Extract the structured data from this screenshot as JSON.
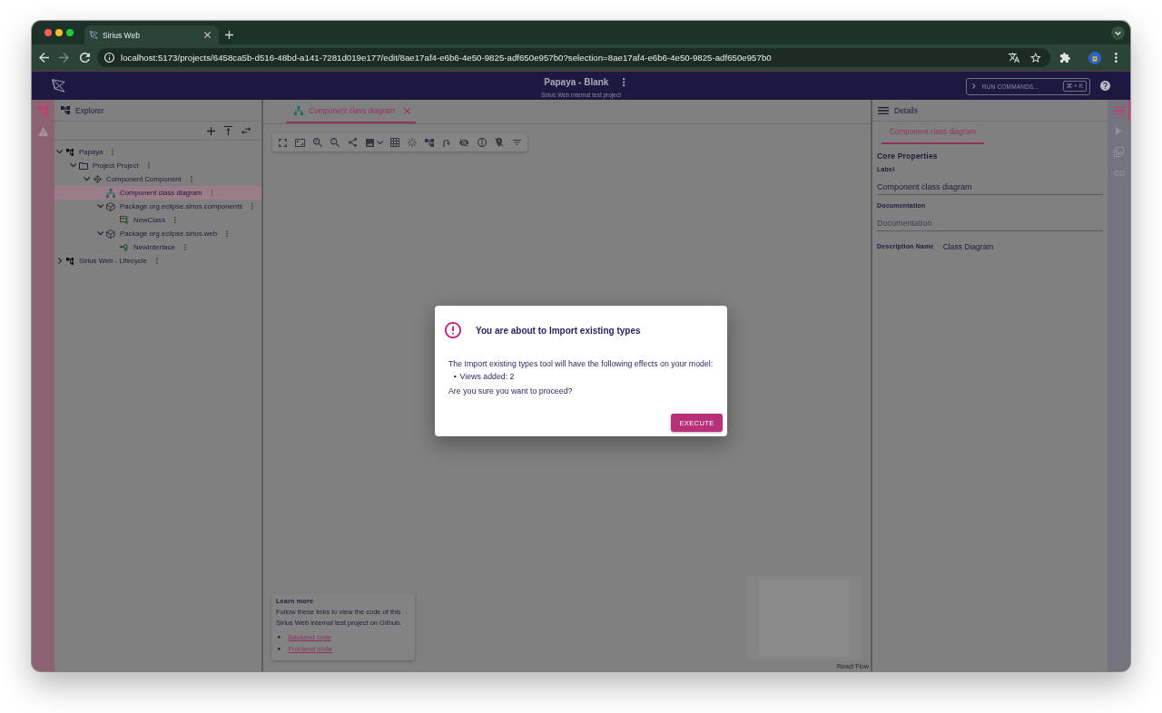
{
  "browser": {
    "tab": {
      "title": "Sirius Web"
    },
    "url": "localhost:5173/projects/6458ca5b-d516-48bd-a141-7281d019e177/edit/8ae17af4-e6b6-4e50-9825-adf650e957b0?selection=8ae17af4-e6b6-4e50-9825-adf650e957b0"
  },
  "app_bar": {
    "title": "Papaya - Blank",
    "subtitle": "Sirius Web internal test project",
    "command_palette": {
      "label": "RUN COMMANDS...",
      "shortcut": "⌘ + K"
    }
  },
  "left_sidebar": {
    "items": [
      {
        "kind": "explorer",
        "selected": true
      },
      {
        "kind": "validation",
        "selected": false
      }
    ]
  },
  "explorer": {
    "title": "Explorer",
    "tree": [
      {
        "label": "Papaya",
        "kind": "model",
        "expanded": true,
        "selected": false,
        "children": [
          {
            "label": "Project Project",
            "kind": "folder",
            "expanded": true,
            "selected": false,
            "children": [
              {
                "label": "Component Component",
                "kind": "component",
                "expanded": true,
                "selected": false,
                "children": [
                  {
                    "label": "Component class diagram",
                    "kind": "diagram",
                    "selected": true
                  },
                  {
                    "label": "Package org.eclipse.sirius.components",
                    "kind": "package",
                    "expanded": true,
                    "selected": false,
                    "children": [
                      {
                        "label": "NewClass",
                        "kind": "class",
                        "selected": false
                      }
                    ]
                  },
                  {
                    "label": "Package org.eclipse.sirius.web",
                    "kind": "package",
                    "expanded": true,
                    "selected": false,
                    "children": [
                      {
                        "label": "NewInterface",
                        "kind": "interface",
                        "selected": false
                      }
                    ]
                  }
                ]
              }
            ]
          }
        ]
      },
      {
        "label": "Sirius Web - Lifecycle",
        "kind": "model",
        "expanded": false,
        "selected": false
      }
    ]
  },
  "editor": {
    "tabs": [
      {
        "label": "Component class diagram",
        "selected": true
      }
    ],
    "learn_more": {
      "title": "Learn more",
      "text": "Follow these links to view the code of this Sirius Web internal test project on Github.",
      "links": [
        "Backend code",
        "Frontend code"
      ]
    },
    "attribution": "React Flow"
  },
  "details": {
    "title": "Details",
    "tabs": [
      {
        "label": "Component class diagram",
        "selected": true
      }
    ],
    "section": "Core Properties",
    "fields": [
      {
        "kind": "textfield",
        "label": "Label",
        "value": "Component class diagram"
      },
      {
        "kind": "textfield",
        "label": "Documentation",
        "placeholder": "Documentation"
      },
      {
        "kind": "label",
        "label": "Description Name",
        "value": "Class Diagram"
      }
    ]
  },
  "right_sidebar": {
    "items": [
      {
        "kind": "details",
        "selected": true
      },
      {
        "kind": "run",
        "selected": false
      },
      {
        "kind": "representations",
        "selected": false
      },
      {
        "kind": "links",
        "selected": false
      }
    ]
  },
  "dialog": {
    "title": "You are about to Import existing types",
    "text": "The Import existing types tool will have the following effects on your model:",
    "effects": [
      "Views added: 2"
    ],
    "question": "Are you sure you want to proceed?",
    "button": "EXECUTE"
  }
}
